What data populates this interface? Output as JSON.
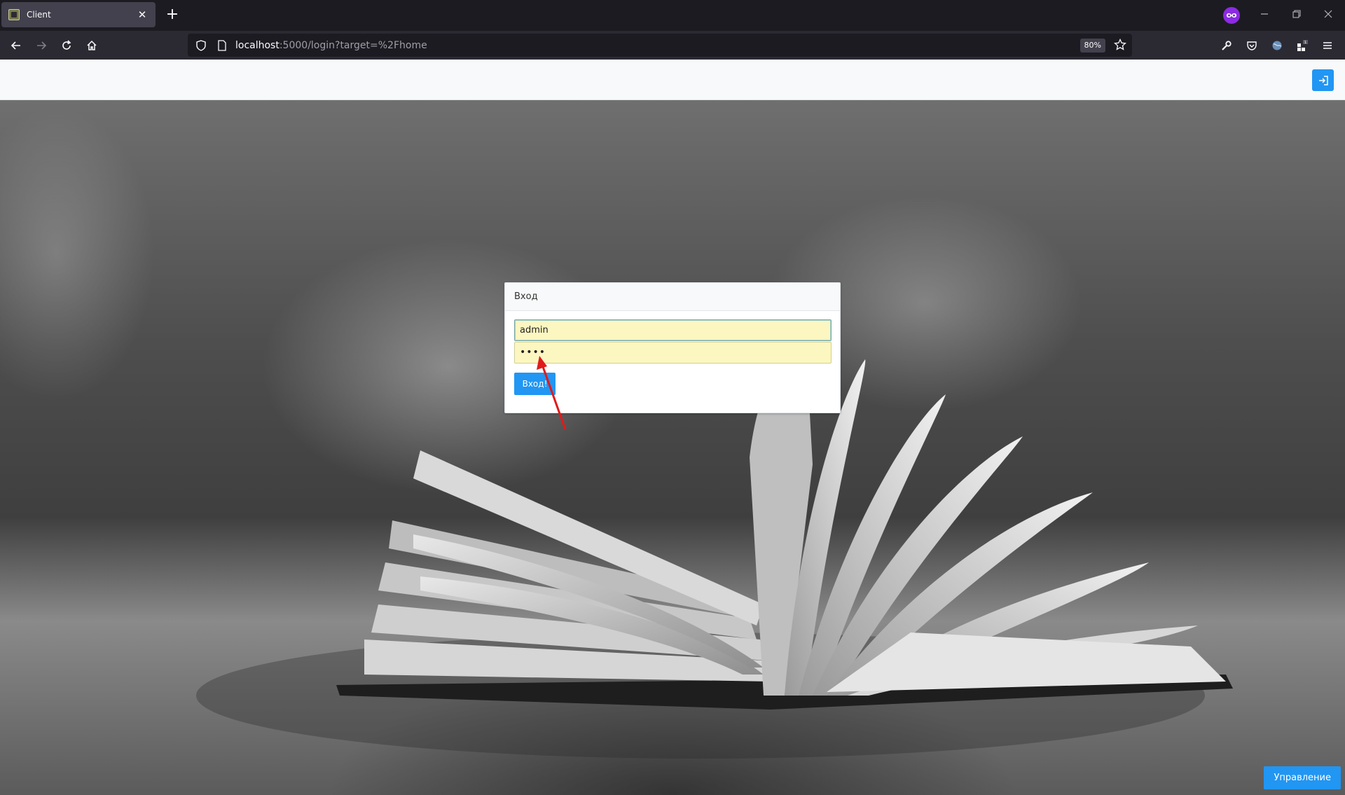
{
  "browser": {
    "tab_title": "Client",
    "tab_close": "✕",
    "new_tab": "+",
    "url_host": "localhost",
    "url_rest": ":5000/login?target=%2Fhome",
    "zoom": "80%",
    "colors": {
      "private_badge": "#8b2be2"
    }
  },
  "app": {
    "login_card": {
      "title": "Вход",
      "username_value": "admin",
      "password_masked": "••••",
      "submit_label": "Вход!"
    },
    "manage_button_label": "Управление",
    "accent_color": "#2196f3"
  },
  "icons": {
    "back": "arrow-left-icon",
    "forward": "arrow-right-icon",
    "reload": "reload-icon",
    "home": "home-icon",
    "shield": "shield-icon",
    "page": "page-icon",
    "star": "star-icon",
    "wrench": "wrench-icon",
    "pocket": "pocket-icon",
    "globe": "globe-icon",
    "extensions": "extensions-icon",
    "menu": "hamburger-menu-icon",
    "login": "login-icon"
  }
}
